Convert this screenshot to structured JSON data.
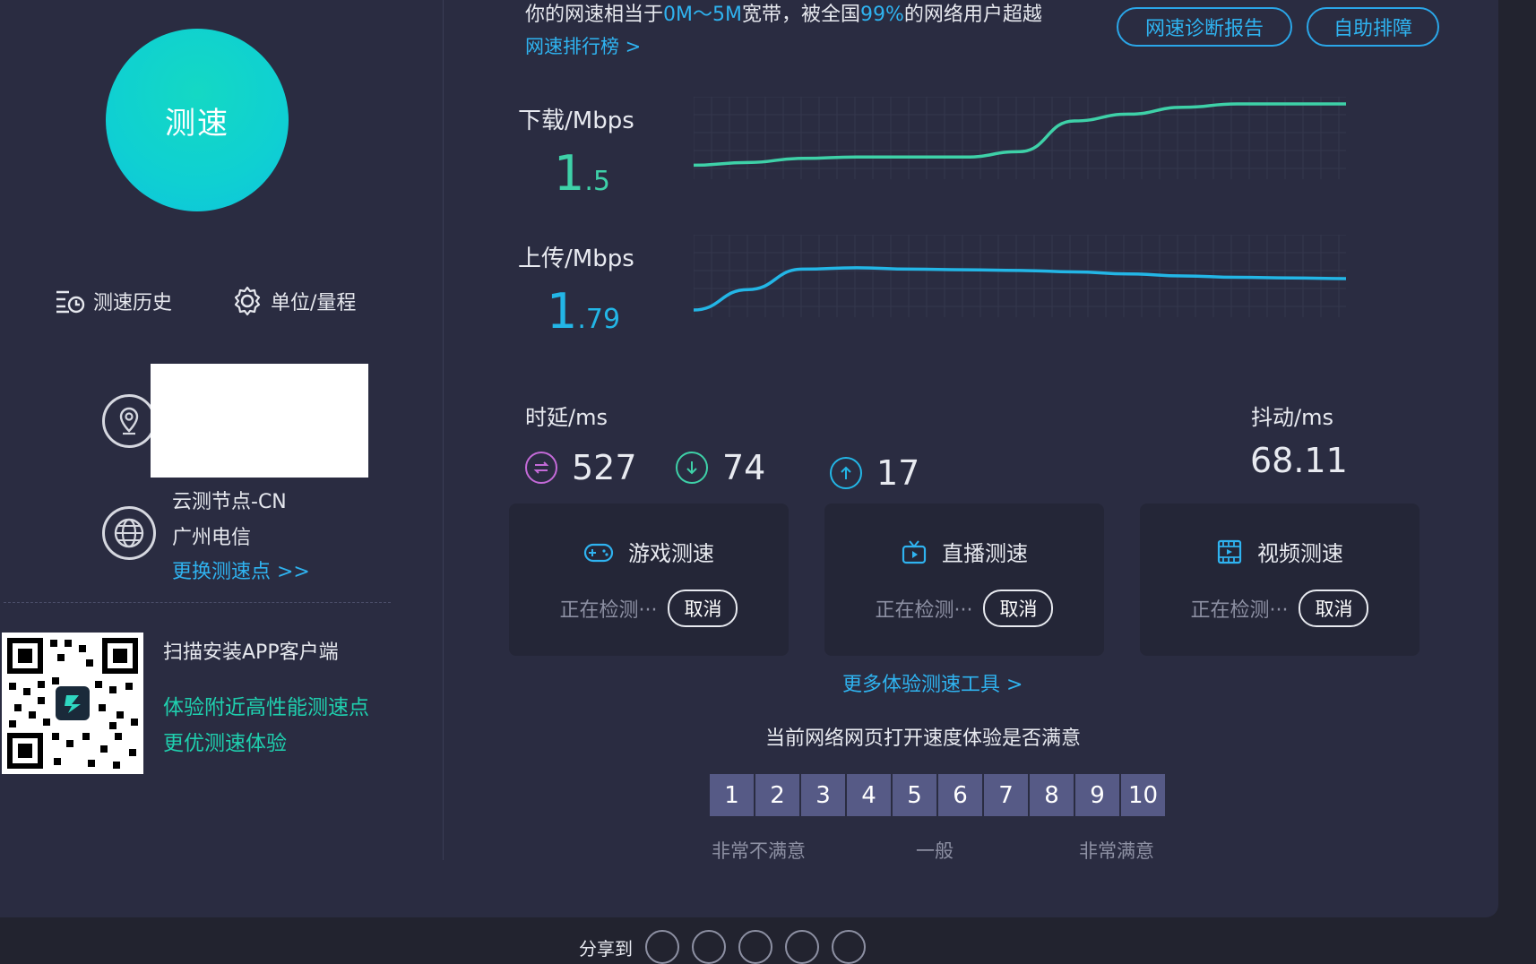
{
  "speed_button": "测速",
  "left": {
    "history_label": "测速历史",
    "units_label": "单位/量程",
    "node_name": "云测节点-CN",
    "isp": "广州电信",
    "change_node": "更换测速点 >>",
    "qr_title": "扫描安装APP客户端",
    "qr_line1": "体验附近高性能测速点",
    "qr_line2": "更优测速体验"
  },
  "top": {
    "rank_prefix": "你的网速相当于",
    "rank_range": "0M～5M",
    "rank_mid": "宽带，被全国",
    "rank_pct": "99%",
    "rank_suffix": "的网络用户超越",
    "rank_link": "网速排行榜 >",
    "btn_report": "网速诊断报告",
    "btn_self": "自助排障"
  },
  "download": {
    "label": "下载/Mbps",
    "int": "1",
    "dec": ".5",
    "color": "#3ed1a8"
  },
  "upload": {
    "label": "上传/Mbps",
    "int": "1",
    "dec": ".79",
    "color": "#23b6e6"
  },
  "latency": {
    "label": "时延/ms",
    "idle": "527",
    "down": "74",
    "up": "17",
    "jitter_label": "抖动/ms",
    "jitter": "68.11"
  },
  "app_tests": [
    {
      "name": "游戏测速",
      "icon": "gamepad-icon",
      "status": "正在检测···",
      "cancel": "取消"
    },
    {
      "name": "直播测速",
      "icon": "tv-icon",
      "status": "正在检测···",
      "cancel": "取消"
    },
    {
      "name": "视频测速",
      "icon": "film-icon",
      "status": "正在检测···",
      "cancel": "取消"
    }
  ],
  "more_tools": "更多体验测速工具 >",
  "survey": {
    "question": "当前网络网页打开速度体验是否满意",
    "scores": [
      "1",
      "2",
      "3",
      "4",
      "5",
      "6",
      "7",
      "8",
      "9",
      "10"
    ],
    "low": "非常不满意",
    "mid": "一般",
    "high": "非常满意"
  },
  "share_label": "分享到",
  "chart_data": [
    {
      "type": "line",
      "series": [
        {
          "values": [
            0.1,
            0.14,
            0.2,
            0.22,
            0.22,
            0.22,
            0.3,
            0.75,
            0.85,
            0.95,
            1.0,
            1.0,
            1.0
          ]
        }
      ]
    },
    {
      "type": "line",
      "series": [
        {
          "values": [
            0.0,
            0.3,
            0.6,
            0.62,
            0.6,
            0.59,
            0.58,
            0.56,
            0.53,
            0.5,
            0.48,
            0.47,
            0.46
          ]
        }
      ]
    }
  ]
}
